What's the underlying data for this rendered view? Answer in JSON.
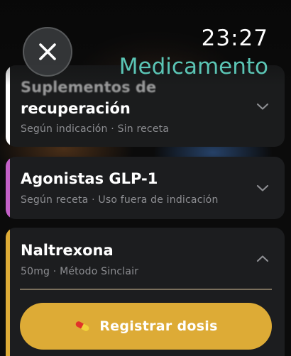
{
  "status": {
    "time": "23:27"
  },
  "header": {
    "title": "Medicamento",
    "close_icon": "close-icon"
  },
  "colors": {
    "title": "#5bc5b5",
    "accent_white": "#ffffff",
    "accent_purple": "#c361c8",
    "accent_gold": "#ddab36",
    "button": "#ddab36"
  },
  "cards": [
    {
      "title_line1": "Suplementos de",
      "title_line2": "recuperación",
      "subtitle": "Según indicación · Sin receta",
      "expanded": false,
      "accent": "#ffffff"
    },
    {
      "title": "Agonistas GLP-1",
      "subtitle": "Según receta · Uso fuera de indicación",
      "expanded": false,
      "accent": "#c361c8"
    },
    {
      "title": "Naltrexona",
      "subtitle": "50mg · Método Sinclair",
      "expanded": true,
      "accent": "#ddab36"
    }
  ],
  "action": {
    "label": "Registrar dosis",
    "icon": "pill-icon"
  }
}
